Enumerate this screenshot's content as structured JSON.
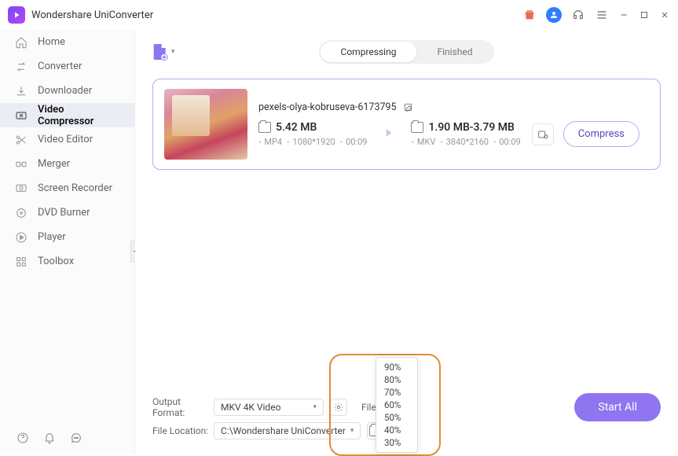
{
  "app": {
    "title": "Wondershare UniConverter"
  },
  "sidebar": {
    "items": [
      {
        "label": "Home"
      },
      {
        "label": "Converter"
      },
      {
        "label": "Downloader"
      },
      {
        "label": "Video Compressor"
      },
      {
        "label": "Video Editor"
      },
      {
        "label": "Merger"
      },
      {
        "label": "Screen Recorder"
      },
      {
        "label": "DVD Burner"
      },
      {
        "label": "Player"
      },
      {
        "label": "Toolbox"
      }
    ]
  },
  "tabs": {
    "compressing": "Compressing",
    "finished": "Finished"
  },
  "file": {
    "name": "pexels-olya-kobruseva-6173795",
    "src": {
      "size": "5.42 MB",
      "format": "MP4",
      "resolution": "1080*1920",
      "duration": "00:09"
    },
    "dst": {
      "size": "1.90 MB-3.79 MB",
      "format": "MKV",
      "resolution": "3840*2160",
      "duration": "00:09"
    },
    "compress_label": "Compress"
  },
  "bottom": {
    "output_format_label": "Output Format:",
    "output_format_value": "MKV 4K Video",
    "file_location_label": "File Location:",
    "file_location_value": "C:\\Wondershare UniConverter",
    "file_size_label": "File Size:",
    "start_all_label": "Start All"
  },
  "dropdown": {
    "options": [
      "90%",
      "80%",
      "70%",
      "60%",
      "50%",
      "40%",
      "30%"
    ]
  }
}
